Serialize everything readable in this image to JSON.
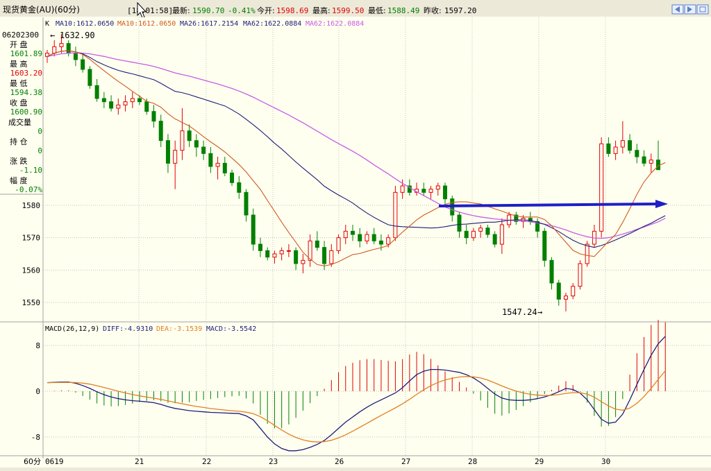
{
  "window": {
    "title": "现货黄金(AU)(60分)",
    "time": "[18:01:58]",
    "nav_icons": [
      "prev-icon",
      "next-icon",
      "restore-icon"
    ]
  },
  "quote": {
    "latest_label": "最新:",
    "latest": "1590.70",
    "change_pct": "-0.41%",
    "open_label": "今开:",
    "open": "1598.69",
    "high_label": "最高:",
    "high": "1599.50",
    "low_label": "最低:",
    "low": "1588.49",
    "prev_label": "昨收:",
    "prev": "1597.20"
  },
  "colors": {
    "up": "#E00000",
    "down": "#008000",
    "ma10": "#D05A1E",
    "ma26": "#1C1C7A",
    "ma62": "#C65CE6",
    "arrow": "#1E1EC8",
    "grid": "#C0C0C0"
  },
  "ma_bar": {
    "k": "K",
    "ma10a": "MA10:1612.0650",
    "ma10b": "MA10:1612.0650",
    "ma26": "MA26:1617.2154",
    "ma62": "MA62:1622.0884",
    "ma62b": "MA62:1622.0884"
  },
  "info": {
    "date": "06202300",
    "open_l": "开 盘",
    "open_v": "1601.89",
    "high_l": "最 高",
    "high_v": "1603.20",
    "low_l": "最 低",
    "low_v": "1594.38",
    "close_l": "收 盘",
    "close_v": "1600.90",
    "vol_l": "成交量",
    "vol_v": "0",
    "hold_l": "持 仓",
    "hold_v": "0",
    "chg_l": "涨 跌",
    "chg_v": "-1.10",
    "amp_l": "幅 度",
    "amp_v": "-0.07%"
  },
  "macd_bar": {
    "name": "MACD(26,12,9)",
    "diff": "DIFF:-4.9310",
    "dea": "DEA:-3.1539",
    "macd": "MACD:-3.5542"
  },
  "footer": {
    "period": "60分"
  },
  "chart_data": [
    {
      "type": "candlestick",
      "title": "现货黄金(AU)(60分)",
      "yticks": [
        1550,
        1560,
        1570,
        1580
      ],
      "ylim": [
        1543,
        1640
      ],
      "x_ticks": [
        "0619",
        "21",
        "22",
        "23",
        "26",
        "27",
        "28",
        "29",
        "30"
      ],
      "annotations": {
        "max": "1632.90",
        "min": "1547.24"
      },
      "grid": true,
      "horizontal_arrow_level": 1580,
      "ohlc": [
        [
          1626,
          1628,
          1624,
          1627
        ],
        [
          1627,
          1631,
          1626,
          1629
        ],
        [
          1629,
          1632.9,
          1627,
          1630
        ],
        [
          1630,
          1631,
          1626,
          1627
        ],
        [
          1627,
          1629,
          1623,
          1625
        ],
        [
          1625,
          1627,
          1621,
          1622
        ],
        [
          1622,
          1623,
          1616,
          1617
        ],
        [
          1617,
          1619,
          1612,
          1613
        ],
        [
          1613,
          1615,
          1610,
          1612
        ],
        [
          1612,
          1614,
          1609,
          1610
        ],
        [
          1610,
          1613,
          1608,
          1611
        ],
        [
          1611,
          1614,
          1609,
          1612
        ],
        [
          1612,
          1615,
          1610,
          1613
        ],
        [
          1613,
          1614,
          1611,
          1612
        ],
        [
          1612,
          1613,
          1608,
          1609
        ],
        [
          1609,
          1611,
          1604,
          1606
        ],
        [
          1606,
          1608,
          1598,
          1600
        ],
        [
          1600,
          1602,
          1590,
          1593
        ],
        [
          1593,
          1600,
          1585,
          1597
        ],
        [
          1597,
          1610,
          1594,
          1603
        ],
        [
          1603,
          1605,
          1598,
          1600
        ],
        [
          1600,
          1602,
          1595,
          1598
        ],
        [
          1598,
          1600,
          1594,
          1596
        ],
        [
          1596,
          1598,
          1590,
          1592
        ],
        [
          1592,
          1595,
          1588,
          1593
        ],
        [
          1593,
          1595,
          1589,
          1590
        ],
        [
          1590,
          1591,
          1586,
          1587
        ],
        [
          1587,
          1589,
          1582,
          1584
        ],
        [
          1584,
          1585,
          1575,
          1577
        ],
        [
          1577,
          1579,
          1566,
          1568
        ],
        [
          1568,
          1570,
          1564,
          1566
        ],
        [
          1566,
          1567,
          1563,
          1564
        ],
        [
          1564,
          1566,
          1562,
          1565
        ],
        [
          1565,
          1567,
          1563,
          1566
        ],
        [
          1566,
          1568,
          1564,
          1566
        ],
        [
          1566,
          1567,
          1560,
          1562
        ],
        [
          1562,
          1565,
          1559,
          1563
        ],
        [
          1563,
          1571,
          1561,
          1569
        ],
        [
          1569,
          1572,
          1566,
          1567
        ],
        [
          1567,
          1569,
          1560,
          1562
        ],
        [
          1562,
          1568,
          1561,
          1566
        ],
        [
          1566,
          1571,
          1565,
          1570
        ],
        [
          1570,
          1574,
          1568,
          1572
        ],
        [
          1572,
          1574,
          1569,
          1571
        ],
        [
          1571,
          1573,
          1567,
          1569
        ],
        [
          1569,
          1572,
          1568,
          1571
        ],
        [
          1571,
          1573,
          1568,
          1569
        ],
        [
          1569,
          1571,
          1566,
          1568
        ],
        [
          1568,
          1571,
          1567,
          1570
        ],
        [
          1570,
          1586,
          1569,
          1584
        ],
        [
          1584,
          1588,
          1582,
          1586
        ],
        [
          1586,
          1588,
          1583,
          1584
        ],
        [
          1584,
          1587,
          1583,
          1585
        ],
        [
          1585,
          1587,
          1583,
          1584
        ],
        [
          1584,
          1586,
          1582,
          1585
        ],
        [
          1585,
          1587,
          1583,
          1586
        ],
        [
          1586,
          1587,
          1580,
          1582
        ],
        [
          1582,
          1583,
          1575,
          1577
        ],
        [
          1577,
          1578,
          1570,
          1572
        ],
        [
          1572,
          1574,
          1568,
          1570
        ],
        [
          1570,
          1573,
          1569,
          1572
        ],
        [
          1572,
          1574,
          1570,
          1573
        ],
        [
          1573,
          1574,
          1570,
          1571
        ],
        [
          1571,
          1572,
          1567,
          1568
        ],
        [
          1568,
          1576,
          1565,
          1574
        ],
        [
          1574,
          1578,
          1573,
          1577
        ],
        [
          1577,
          1578,
          1574,
          1575
        ],
        [
          1575,
          1577,
          1573,
          1576
        ],
        [
          1576,
          1578,
          1574,
          1575
        ],
        [
          1575,
          1576,
          1570,
          1572
        ],
        [
          1572,
          1573,
          1561,
          1563
        ],
        [
          1563,
          1564,
          1554,
          1556
        ],
        [
          1556,
          1557,
          1549,
          1551
        ],
        [
          1551,
          1553,
          1547.24,
          1552
        ],
        [
          1552,
          1556,
          1551,
          1555
        ],
        [
          1555,
          1563,
          1554,
          1562
        ],
        [
          1562,
          1569,
          1561,
          1568
        ],
        [
          1568,
          1574,
          1567,
          1572
        ],
        [
          1572,
          1601,
          1570,
          1599
        ],
        [
          1599,
          1601,
          1595,
          1596
        ],
        [
          1596,
          1600,
          1594,
          1598
        ],
        [
          1598,
          1606,
          1596,
          1600
        ],
        [
          1600,
          1602,
          1596,
          1597
        ],
        [
          1597,
          1599,
          1593,
          1595
        ],
        [
          1595,
          1597,
          1592,
          1593
        ],
        [
          1593,
          1596,
          1590,
          1594
        ],
        [
          1594,
          1600,
          1592,
          1591
        ]
      ],
      "series": [
        {
          "name": "MA10",
          "values": [
            1626,
            1627,
            1627.6,
            1627.8,
            1627.4,
            1626.6,
            1625.1,
            1623.3,
            1621.6,
            1619.9,
            1618.3,
            1616.8,
            1615.2,
            1613.7,
            1612.1,
            1611.5,
            1610.3,
            1608.3,
            1606.7,
            1605.6,
            1604.5,
            1602.9,
            1601.2,
            1599.6,
            1598.1,
            1596.5,
            1594.6,
            1592.6,
            1590.3,
            1587.6,
            1584.9,
            1581.5,
            1578.2,
            1574.8,
            1571.6,
            1568.6,
            1565.5,
            1563.4,
            1561.7,
            1561.3,
            1561.7,
            1562.6,
            1563.7,
            1564.8,
            1565.1,
            1565.8,
            1566.4,
            1566.9,
            1567.6,
            1569.7,
            1571.7,
            1573.6,
            1575.5,
            1577,
            1578.1,
            1579.3,
            1580.3,
            1580.9,
            1581.1,
            1581.1,
            1580.7,
            1580.4,
            1579.7,
            1578.9,
            1578.2,
            1577.4,
            1576.7,
            1576.4,
            1576.4,
            1576.4,
            1575.6,
            1573.7,
            1571.1,
            1568.6,
            1566.1,
            1565,
            1564.5,
            1564.2,
            1566.5,
            1568.9,
            1571,
            1574.7,
            1579,
            1583.4,
            1587.2,
            1590,
            1592.2,
            1593.2
          ]
        },
        {
          "name": "MA26",
          "values": [
            1626,
            1627,
            1627.6,
            1627.8,
            1627.4,
            1626.8,
            1625.7,
            1624.4,
            1623.4,
            1622.5,
            1621.7,
            1621.1,
            1620.6,
            1620,
            1619.4,
            1618.8,
            1617.7,
            1616.4,
            1615.2,
            1614.8,
            1614.2,
            1613.5,
            1612.8,
            1612.1,
            1611.4,
            1610.7,
            1609.5,
            1608.2,
            1606.6,
            1604.9,
            1603.1,
            1601.2,
            1599.2,
            1597.4,
            1595.4,
            1593.4,
            1591.5,
            1589.7,
            1587.9,
            1585.9,
            1584.5,
            1583.2,
            1582,
            1580.7,
            1579.1,
            1577.6,
            1576.3,
            1575.1,
            1574,
            1573.6,
            1573.4,
            1573.3,
            1573.2,
            1573.1,
            1573,
            1573.1,
            1573.4,
            1573.8,
            1574.1,
            1574.2,
            1574.4,
            1574.6,
            1574.8,
            1574.8,
            1575.1,
            1575.4,
            1575.5,
            1575.5,
            1575.3,
            1574.8,
            1574.1,
            1573.1,
            1571.9,
            1570.5,
            1569.2,
            1568.2,
            1567.5,
            1567,
            1567.6,
            1568.4,
            1569.3,
            1570.3,
            1571.3,
            1572.4,
            1573.5,
            1574.5,
            1575.7,
            1576.8
          ]
        },
        {
          "name": "MA62",
          "values": [
            1626,
            1626.4,
            1626.8,
            1627,
            1627.1,
            1627,
            1626.8,
            1626.4,
            1626,
            1625.5,
            1625,
            1624.6,
            1624.2,
            1623.8,
            1623.4,
            1622.9,
            1622.3,
            1621.6,
            1620.9,
            1620.4,
            1619.9,
            1619.3,
            1618.7,
            1618.1,
            1617.5,
            1616.8,
            1616.1,
            1615.3,
            1614.4,
            1613.4,
            1612.3,
            1611.2,
            1610.1,
            1609,
            1607.9,
            1606.7,
            1605.5,
            1604.2,
            1602.9,
            1601.6,
            1600.3,
            1599.1,
            1597.9,
            1596.7,
            1595.4,
            1594,
            1592.5,
            1591.1,
            1589.7,
            1588.2,
            1586.8,
            1585.5,
            1584.2,
            1583,
            1581.8,
            1580.6,
            1579.5,
            1578.6,
            1577.9,
            1577.3,
            1576.8,
            1576.4,
            1576.1,
            1575.8,
            1575.6,
            1575.4,
            1575.3,
            1575.1,
            1574.9,
            1574.6,
            1574.2,
            1573.7,
            1573.1,
            1572.4,
            1571.6,
            1570.9,
            1570.3,
            1569.9,
            1569.8,
            1570,
            1570.5,
            1571.1,
            1571.8,
            1572.6,
            1573.3,
            1574.1,
            1574.9,
            1576
          ]
        }
      ]
    },
    {
      "type": "macd",
      "title": "MACD(26,12,9)",
      "yticks": [
        8,
        0,
        -8
      ],
      "ylim": [
        -11,
        10
      ],
      "diff": [
        1.5,
        1.55,
        1.6,
        1.62,
        1.4,
        1.0,
        0.5,
        -0.1,
        -0.6,
        -1.0,
        -1.3,
        -1.5,
        -1.65,
        -1.75,
        -1.85,
        -2.0,
        -2.3,
        -2.7,
        -3.0,
        -3.2,
        -3.4,
        -3.5,
        -3.6,
        -3.7,
        -3.75,
        -3.8,
        -3.85,
        -3.9,
        -4.3,
        -5.0,
        -6.5,
        -8.0,
        -9.2,
        -10.0,
        -10.4,
        -10.4,
        -10.2,
        -9.8,
        -9.3,
        -8.6,
        -7.6,
        -6.5,
        -5.4,
        -4.5,
        -3.6,
        -2.8,
        -2.1,
        -1.5,
        -0.9,
        -0.3,
        0.6,
        1.8,
        2.9,
        3.5,
        3.8,
        3.8,
        3.7,
        3.5,
        3.3,
        2.9,
        2.3,
        1.5,
        0.5,
        -0.5,
        -1.2,
        -1.5,
        -1.6,
        -1.6,
        -1.5,
        -1.3,
        -1.0,
        -0.6,
        -0.1,
        0.5,
        0.3,
        -0.3,
        -1.5,
        -3.2,
        -4.9,
        -5.6,
        -5.4,
        -4.0,
        -1.5,
        1.2,
        3.8,
        6.3,
        8.3,
        9.6
      ]
    }
  ]
}
